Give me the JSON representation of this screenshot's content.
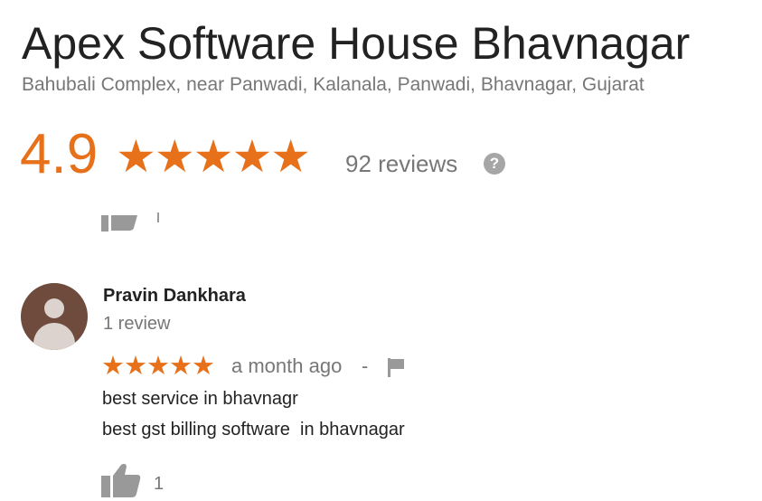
{
  "place": {
    "name": "Apex Software House Bhavnagar",
    "address": "Bahubali Complex, near Panwadi, Kalanala, Panwadi, Bhavnagar, Gujarat"
  },
  "summary": {
    "rating": "4.9",
    "stars": "★★★★★",
    "review_count": "92 reviews",
    "help_icon": "?"
  },
  "review": {
    "author": "Pravin Dankhara",
    "author_reviews": "1 review",
    "stars": "★★★★★",
    "rating": 5,
    "time": "a month ago",
    "separator": "-",
    "text_lines": [
      "best service in bhavnagr",
      "best gst billing software  in bhavnagar"
    ],
    "likes": "1"
  },
  "icons": {
    "help": "question-circle-icon",
    "flag": "flag-icon",
    "like": "thumbs-up-icon",
    "avatar": "person-icon"
  },
  "colors": {
    "accent": "#e7711b",
    "muted": "#777777",
    "icon": "#999999",
    "avatar_bg": "#6f4b3e"
  }
}
